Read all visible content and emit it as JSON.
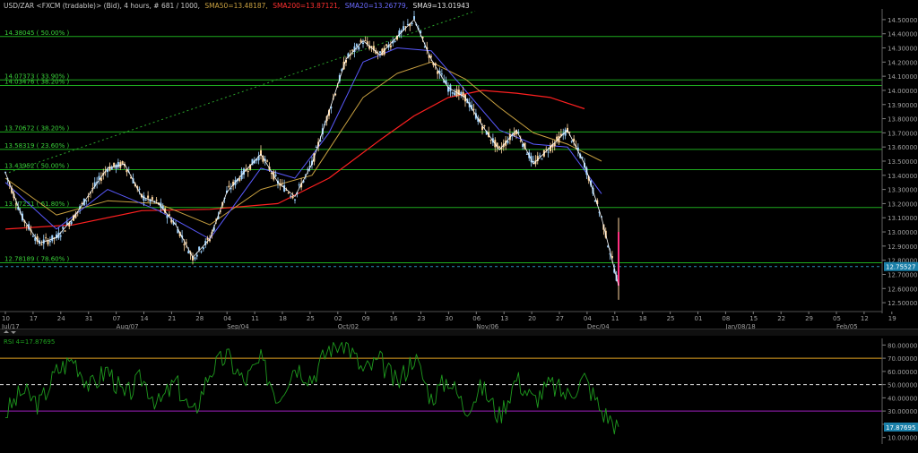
{
  "header": {
    "symbol": "USD/ZAR <FXCM (tradable)> (Bid), 4 hours, # 681 / 1000,",
    "sma50": "SMA50=13.48187,",
    "sma200": "SMA200=13.87121,",
    "sma20": "SMA20=13.26779,",
    "sma9": "SMA9=13.01943"
  },
  "colors": {
    "background": "#000000",
    "price_up": "#9fd3ff",
    "price_down": "#ffd69f",
    "sma50": "#c8a040",
    "sma200": "#ff2020",
    "sma20": "#5a5aff",
    "sma9": "#ffffff",
    "fib": "#1eaa1e",
    "rsi_line": "#1e9a1e",
    "rsi_70": "#e0a020",
    "rsi_30": "#a020c0",
    "last_price_box": "#1a7fa8",
    "axis_text": "#a0a0a0"
  },
  "chart_data": [
    {
      "type": "line",
      "panel": "price",
      "ylim": [
        12.45,
        14.55
      ],
      "y_ticks": [
        "14.50000",
        "14.40000",
        "14.30000",
        "14.20000",
        "14.10000",
        "14.00000",
        "13.90000",
        "13.80000",
        "13.70000",
        "13.60000",
        "13.50000",
        "13.40000",
        "13.30000",
        "13.20000",
        "13.10000",
        "13.00000",
        "12.90000",
        "12.80000",
        "12.70000",
        "12.60000",
        "12.50000"
      ],
      "y_tick_values": [
        14.5,
        14.4,
        14.3,
        14.2,
        14.1,
        14.0,
        13.9,
        13.8,
        13.7,
        13.6,
        13.5,
        13.4,
        13.3,
        13.2,
        13.1,
        13.0,
        12.9,
        12.8,
        12.7,
        12.6,
        12.5
      ],
      "x_day_labels": [
        "10",
        "17",
        "24",
        "31",
        "07",
        "14",
        "21",
        "28",
        "04",
        "11",
        "18",
        "25",
        "02",
        "09",
        "16",
        "23",
        "30",
        "06",
        "13",
        "20",
        "27",
        "04",
        "11",
        "18",
        "25",
        "01",
        "08",
        "15",
        "22",
        "29",
        "05",
        "12",
        "19"
      ],
      "x_month_labels": [
        {
          "label": "Jul/17",
          "day_index": 0
        },
        {
          "label": "Aug/07",
          "day_index": 4
        },
        {
          "label": "Sep/04",
          "day_index": 8
        },
        {
          "label": "Oct/02",
          "day_index": 12
        },
        {
          "label": "Nov/06",
          "day_index": 17
        },
        {
          "label": "Dec/04",
          "day_index": 21
        },
        {
          "label": "Jan/08/18",
          "day_index": 26
        },
        {
          "label": "Feb/05",
          "day_index": 30
        }
      ],
      "fib_levels": [
        {
          "label": "14.38045 ( 50.00% )",
          "value": 14.38045
        },
        {
          "label": "14.07373 ( 33.90% )",
          "value": 14.07373
        },
        {
          "label": "14.03476 ( 38.20% )",
          "value": 14.03476
        },
        {
          "label": "13.70672 ( 38.20% )",
          "value": 13.70672
        },
        {
          "label": "13.58319 ( 23.60% )",
          "value": 13.58319
        },
        {
          "label": "13.43952 ( 50.00% )",
          "value": 13.43952
        },
        {
          "label": "13.17231 ( 61.80% )",
          "value": 13.17231
        },
        {
          "label": "12.78189 ( 78.60% )",
          "value": 12.78189
        }
      ],
      "last_price": "12.75527",
      "last_price_value": 12.75527,
      "price_path": [
        [
          0,
          13.42
        ],
        [
          1,
          13.1
        ],
        [
          2,
          12.92
        ],
        [
          3,
          12.96
        ],
        [
          4,
          13.1
        ],
        [
          5,
          13.28
        ],
        [
          6,
          13.45
        ],
        [
          7,
          13.48
        ],
        [
          8,
          13.25
        ],
        [
          9,
          13.2
        ],
        [
          10,
          13.05
        ],
        [
          11,
          12.82
        ],
        [
          12,
          12.95
        ],
        [
          13,
          13.28
        ],
        [
          14,
          13.42
        ],
        [
          15,
          13.55
        ],
        [
          16,
          13.35
        ],
        [
          17,
          13.25
        ],
        [
          18,
          13.48
        ],
        [
          19,
          13.85
        ],
        [
          20,
          14.22
        ],
        [
          21,
          14.35
        ],
        [
          22,
          14.25
        ],
        [
          23,
          14.38
        ],
        [
          24,
          14.5
        ],
        [
          25,
          14.22
        ],
        [
          26,
          14.02
        ],
        [
          27,
          13.95
        ],
        [
          28,
          13.75
        ],
        [
          29,
          13.58
        ],
        [
          30,
          13.72
        ],
        [
          31,
          13.48
        ],
        [
          32,
          13.6
        ],
        [
          33,
          13.72
        ],
        [
          34,
          13.48
        ],
        [
          35,
          13.1
        ],
        [
          36,
          12.62
        ]
      ],
      "sma50_path": [
        [
          0,
          13.38
        ],
        [
          3,
          13.12
        ],
        [
          6,
          13.22
        ],
        [
          9,
          13.2
        ],
        [
          12,
          13.05
        ],
        [
          15,
          13.3
        ],
        [
          18,
          13.4
        ],
        [
          21,
          13.95
        ],
        [
          23,
          14.12
        ],
        [
          25,
          14.2
        ],
        [
          27,
          14.08
        ],
        [
          29,
          13.88
        ],
        [
          31,
          13.7
        ],
        [
          33,
          13.62
        ],
        [
          35,
          13.5
        ]
      ],
      "sma200_path": [
        [
          0,
          13.02
        ],
        [
          4,
          13.05
        ],
        [
          8,
          13.15
        ],
        [
          12,
          13.16
        ],
        [
          16,
          13.2
        ],
        [
          19,
          13.38
        ],
        [
          22,
          13.65
        ],
        [
          24,
          13.82
        ],
        [
          26,
          13.95
        ],
        [
          28,
          14.0
        ],
        [
          30,
          13.98
        ],
        [
          32,
          13.95
        ],
        [
          34,
          13.87
        ]
      ],
      "sma20_path": [
        [
          0,
          13.35
        ],
        [
          3,
          13.02
        ],
        [
          6,
          13.3
        ],
        [
          9,
          13.15
        ],
        [
          12,
          12.95
        ],
        [
          15,
          13.45
        ],
        [
          17,
          13.38
        ],
        [
          19,
          13.7
        ],
        [
          21,
          14.2
        ],
        [
          23,
          14.3
        ],
        [
          25,
          14.28
        ],
        [
          27,
          14.0
        ],
        [
          29,
          13.72
        ],
        [
          31,
          13.62
        ],
        [
          33,
          13.6
        ],
        [
          35,
          13.27
        ]
      ]
    },
    {
      "type": "line",
      "panel": "rsi",
      "label": "RSI 4=17.87695",
      "ylim": [
        5,
        85
      ],
      "y_ticks": [
        "80.00000",
        "70.00000",
        "60.00000",
        "50.00000",
        "40.00000",
        "30.00000",
        "20.00000",
        "10.00000"
      ],
      "y_tick_values": [
        80,
        70,
        60,
        50,
        40,
        30,
        20,
        10
      ],
      "levels": [
        70,
        50,
        30
      ],
      "last_value": "17.87695",
      "last_value_num": 17.87695,
      "rsi_path": [
        [
          0,
          28
        ],
        [
          1,
          45
        ],
        [
          2,
          35
        ],
        [
          3,
          60
        ],
        [
          4,
          70
        ],
        [
          5,
          48
        ],
        [
          6,
          62
        ],
        [
          7,
          40
        ],
        [
          8,
          55
        ],
        [
          9,
          35
        ],
        [
          10,
          52
        ],
        [
          11,
          26
        ],
        [
          12,
          60
        ],
        [
          13,
          72
        ],
        [
          14,
          52
        ],
        [
          15,
          68
        ],
        [
          16,
          40
        ],
        [
          17,
          65
        ],
        [
          18,
          55
        ],
        [
          19,
          78
        ],
        [
          20,
          82
        ],
        [
          21,
          60
        ],
        [
          22,
          68
        ],
        [
          23,
          50
        ],
        [
          24,
          72
        ],
        [
          25,
          40
        ],
        [
          26,
          55
        ],
        [
          27,
          32
        ],
        [
          28,
          48
        ],
        [
          29,
          26
        ],
        [
          30,
          55
        ],
        [
          31,
          38
        ],
        [
          32,
          50
        ],
        [
          33,
          42
        ],
        [
          34,
          55
        ],
        [
          35,
          30
        ],
        [
          36,
          18
        ]
      ]
    }
  ]
}
